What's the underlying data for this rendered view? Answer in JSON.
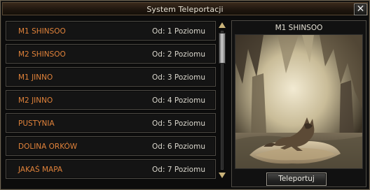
{
  "window": {
    "title": "System Teleportacji",
    "close_icon": "close-icon"
  },
  "maps": [
    {
      "name": "M1 SHINSOO",
      "level": "Od: 1 Poziomu"
    },
    {
      "name": "M2 SHINSOO",
      "level": "Od: 2 Poziomu"
    },
    {
      "name": "M1 JINNO",
      "level": "Od: 3 Poziomu"
    },
    {
      "name": "M2 JINNO",
      "level": "Od: 4 Poziomu"
    },
    {
      "name": "PUSTYNIA",
      "level": "Od: 5 Poziomu"
    },
    {
      "name": "DOLINA ORKÓW",
      "level": "Od: 6 Poziomu"
    },
    {
      "name": "JAKAŚ MAPA",
      "level": "Od: 7 Poziomu"
    }
  ],
  "scrollbar": {
    "up_icon": "arrow-up-icon",
    "down_icon": "arrow-down-icon",
    "position_fraction": 0.0
  },
  "preview": {
    "title": "M1 SHINSOO",
    "image": "wolf-in-cave-preview",
    "teleport_label": "Teleportuj"
  },
  "colors": {
    "map_name": "#e0823a",
    "level_text": "#d9d6cc",
    "title_text": "#e8e3d4"
  }
}
